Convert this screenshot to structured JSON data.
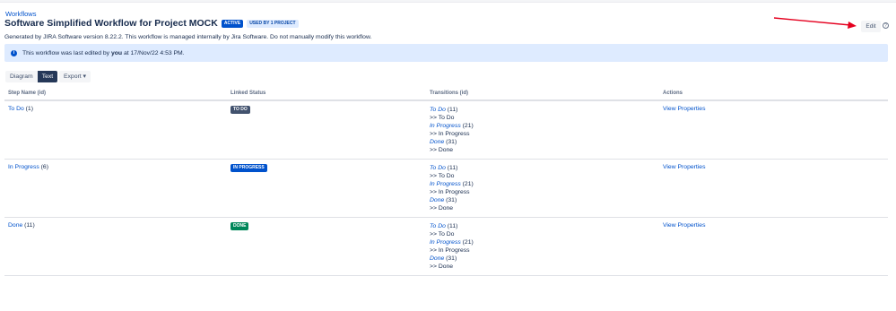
{
  "breadcrumb": "Workflows",
  "title": "Software Simplified Workflow for Project MOCK",
  "badges": {
    "active": "ACTIVE",
    "used_by": "USED BY 1 PROJECT"
  },
  "generated_text": "Generated by JIRA Software version 8.22.2. This workflow is managed internally by Jira Software. Do not manually modify this workflow.",
  "info": {
    "prefix": "This workflow was last edited by ",
    "user": "you",
    "suffix": " at 17/Nov/22 4:53 PM."
  },
  "view_buttons": {
    "diagram": "Diagram",
    "text": "Text",
    "export": "Export"
  },
  "edit_label": "Edit",
  "help_glyph": "?",
  "accent_color": "#0052cc",
  "annotation_arrow_color": "#e5001f",
  "table": {
    "headers": {
      "step": "Step Name (id)",
      "status": "Linked Status",
      "transitions": "Transitions (id)",
      "actions": "Actions"
    },
    "rows": [
      {
        "step_name": "To Do",
        "step_id": " (1)",
        "status": "TO DO",
        "transitions": [
          {
            "name": "To Do",
            "id": " (11)",
            "target": ">> To Do"
          },
          {
            "name": "In Progress",
            "id": " (21)",
            "target": ">> In Progress"
          },
          {
            "name": "Done",
            "id": " (31)",
            "target": ">> Done"
          }
        ],
        "action": "View Properties"
      },
      {
        "step_name": "In Progress",
        "step_id": " (6)",
        "status": "IN PROGRESS",
        "transitions": [
          {
            "name": "To Do",
            "id": " (11)",
            "target": ">> To Do"
          },
          {
            "name": "In Progress",
            "id": " (21)",
            "target": ">> In Progress"
          },
          {
            "name": "Done",
            "id": " (31)",
            "target": ">> Done"
          }
        ],
        "action": "View Properties"
      },
      {
        "step_name": "Done",
        "step_id": " (11)",
        "status": "DONE",
        "transitions": [
          {
            "name": "To Do",
            "id": " (11)",
            "target": ">> To Do"
          },
          {
            "name": "In Progress",
            "id": " (21)",
            "target": ">> In Progress"
          },
          {
            "name": "Done",
            "id": " (31)",
            "target": ">> Done"
          }
        ],
        "action": "View Properties"
      }
    ]
  }
}
